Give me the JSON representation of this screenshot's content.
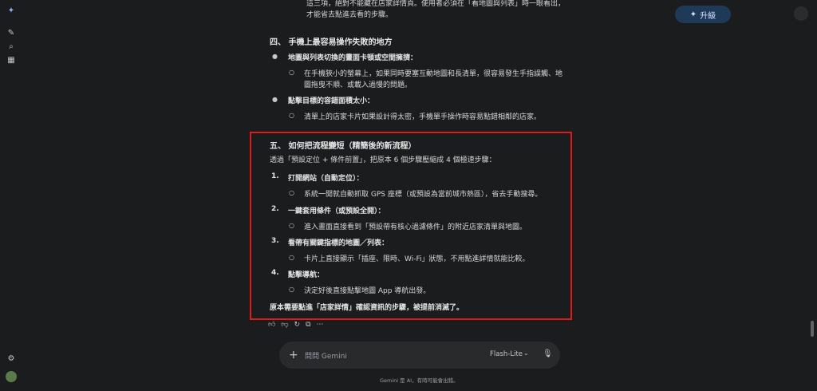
{
  "icons": {
    "gemini_logo": "sparkle-icon",
    "new_chat": "edit-icon",
    "search": "search-icon",
    "apps": "grid-icon",
    "settings": "gear-icon",
    "avatar": "avatar"
  },
  "header": {
    "upgrade_label": "升級"
  },
  "conversation": {
    "intro_line1": "這三項，絕對不能藏在店家詳情頁。使用者必須在「看地圖與列表」時一眼看出，",
    "intro_line2": "才能省去點進去看的步驟。",
    "section4": {
      "heading": "四、 手機上最容易操作失敗的地方",
      "item1_title": "地圖與列表切換的畫面卡頓或空間擁擠：",
      "item1_sub_line1": "在手機狹小的螢幕上，如果同時要塞互動地圖和長清單，很容易發生手指誤觸、地",
      "item1_sub_line2": "圖拖曳不順、或載入過慢的問題。",
      "item2_title": "點擊目標的容錯面積太小：",
      "item2_sub": "清單上的店家卡片如果設計得太密，手機單手操作時容易點錯相鄰的店家。"
    },
    "section5": {
      "heading": "五、 如何把流程變短（精簡後的新流程）",
      "intro": "透過「預設定位 + 條件前置」，把原本 6 個步驟壓縮成 4 個極速步驟：",
      "steps": [
        {
          "num": "1.",
          "title": "打開網站（自動定位）：",
          "detail": "系統一開就自動抓取 GPS 座標（或預設為當前城市熱區），省去手動搜尋。"
        },
        {
          "num": "2.",
          "title": "一鍵套用條件（或預設全開）：",
          "detail": "進入畫面直接看到「預設帶有核心過濾條件」的附近店家清單與地圖。"
        },
        {
          "num": "3.",
          "title": "看帶有關鍵指標的地圖／列表：",
          "detail": "卡片上直接顯示「插座、限時、Wi-Fi」狀態，不用點進詳情就能比較。"
        },
        {
          "num": "4.",
          "title": "點擊導航：",
          "detail": "決定好後直接點擊地圖 App 導航出發。"
        }
      ],
      "conclusion": "原本需要點進「店家詳情」確認資訊的步驟，被提前消滅了。"
    }
  },
  "input": {
    "placeholder": "問問 Gemini",
    "model_label": "Flash-Lite"
  },
  "footer": {
    "disclaimer": "Gemini 是 AI，有時可能會出錯。"
  }
}
